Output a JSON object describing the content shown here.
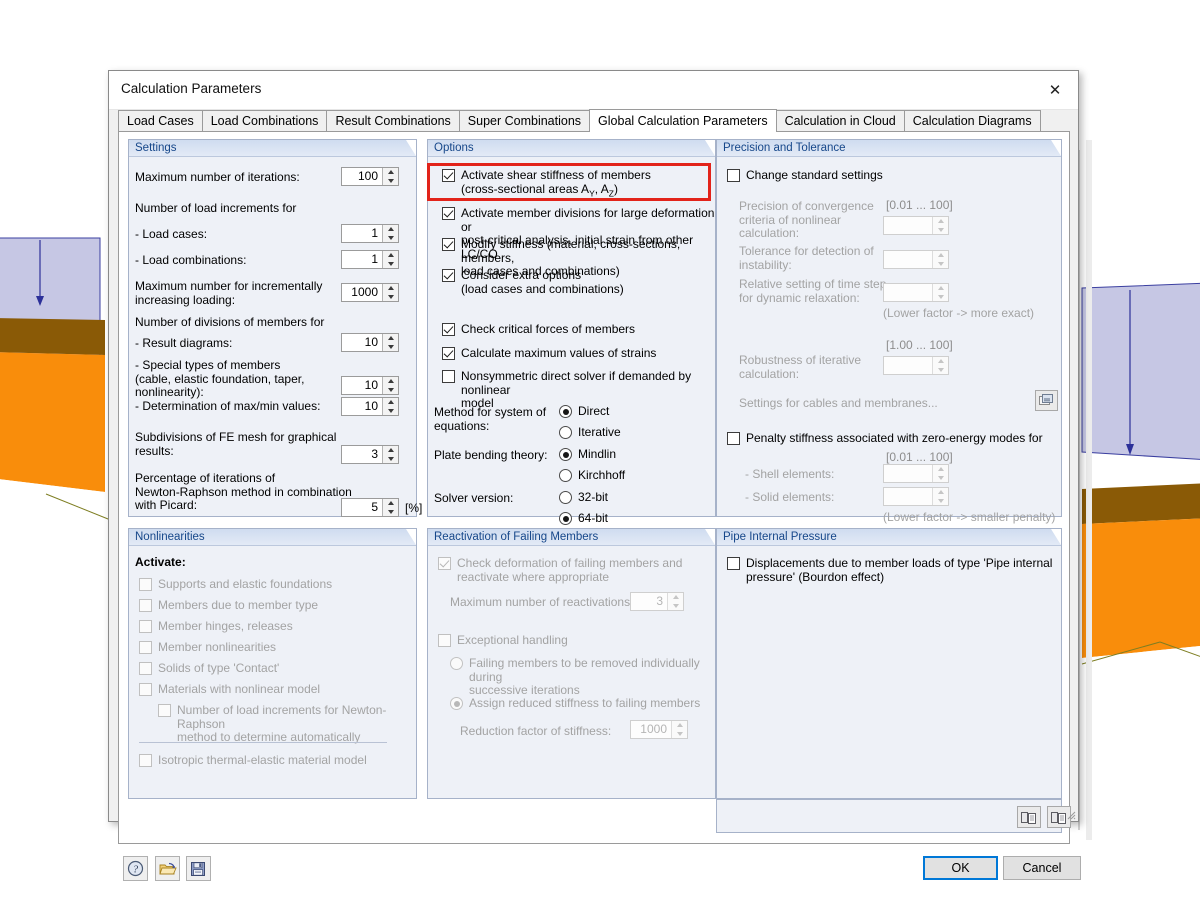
{
  "window": {
    "title": "Calculation Parameters",
    "close_icon": "close-icon"
  },
  "tabs": [
    {
      "label": "Load Cases",
      "active": false
    },
    {
      "label": "Load Combinations",
      "active": false
    },
    {
      "label": "Result Combinations",
      "active": false
    },
    {
      "label": "Super Combinations",
      "active": false
    },
    {
      "label": "Global Calculation Parameters",
      "active": true
    },
    {
      "label": "Calculation in Cloud",
      "active": false
    },
    {
      "label": "Calculation Diagrams",
      "active": false
    }
  ],
  "settings": {
    "title": "Settings",
    "max_iterations_label": "Maximum number of iterations:",
    "max_iterations_value": "100",
    "load_increments_header": "Number of load increments for",
    "load_cases_label": "- Load cases:",
    "load_cases_value": "1",
    "load_combinations_label": "- Load combinations:",
    "load_combinations_value": "1",
    "incremental_label": "Maximum number for incrementally\nincreasing loading:",
    "incremental_value": "1000",
    "divisions_header": "Number of divisions of members for",
    "result_diagrams_label": "- Result diagrams:",
    "result_diagrams_value": "10",
    "special_members_label": "- Special types of members\n  (cable, elastic foundation, taper,\n  nonlinearity):",
    "special_members_value": "10",
    "maxmin_label": "- Determination of max/min values:",
    "maxmin_value": "10",
    "fe_mesh_label": "Subdivisions of FE mesh for graphical\nresults:",
    "fe_mesh_value": "3",
    "newton_raphson_label": "Percentage of iterations of\nNewton-Raphson method in combination\nwith Picard:",
    "newton_raphson_value": "5",
    "newton_raphson_unit": "[%]"
  },
  "options": {
    "title": "Options",
    "shear_stiffness_line1": "Activate shear stiffness of members",
    "shear_stiffness_line2_pre": "(cross-sectional areas A",
    "shear_stiffness_sub1": "Y",
    "shear_stiffness_mid": ", A",
    "shear_stiffness_sub2": "Z",
    "shear_stiffness_end": ")",
    "shear_stiffness_checked": true,
    "highlight_color": "#e2231a",
    "member_divisions": "Activate member divisions for large deformation or\npost-critical analysis, initial strain from other LC/CO",
    "member_divisions_checked": true,
    "modify_stiffness": "Modify stiffness (material, cross-sections, members,\nload cases and combinations)",
    "modify_stiffness_checked": true,
    "extra_options": "Consider extra options\n(load cases and combinations)",
    "extra_options_checked": true,
    "check_critical_forces": "Check critical forces of members",
    "check_critical_forces_checked": true,
    "calc_max_strains": "Calculate maximum values of strains",
    "calc_max_strains_checked": true,
    "nonsymmetric_solver": "Nonsymmetric direct solver if demanded by nonlinear\nmodel",
    "nonsymmetric_solver_checked": false,
    "method_label": "Method for system of\nequations:",
    "method_options": [
      "Direct",
      "Iterative"
    ],
    "method_selected": "Direct",
    "plate_label": "Plate bending theory:",
    "plate_options": [
      "Mindlin",
      "Kirchhoff"
    ],
    "plate_selected": "Mindlin",
    "solver_label": "Solver version:",
    "solver_options": [
      "32-bit",
      "64-bit"
    ],
    "solver_selected": "64-bit"
  },
  "precision": {
    "title": "Precision and Tolerance",
    "change_standard_label": "Change standard settings",
    "change_standard_checked": false,
    "convergence_label": "Precision of convergence\ncriteria of nonlinear\ncalculation:",
    "convergence_range": "[0.01 ... 100]",
    "convergence_value": "",
    "instability_label": "Tolerance for detection of\ninstability:",
    "instability_value": "",
    "timestep_label": "Relative setting of time step\nfor dynamic relaxation:",
    "timestep_value": "",
    "timestep_hint": "(Lower factor -> more exact)",
    "robustness_range": "[1.00 ... 100]",
    "robustness_label": "Robustness of iterative\ncalculation:",
    "robustness_value": "",
    "cables_membranes_label": "Settings for cables and membranes...",
    "cables_membranes_icon": "settings-dialog-icon",
    "penalty_label": "Penalty stiffness associated with zero-energy modes for",
    "penalty_checked": false,
    "penalty_range": "[0.01 ... 100]",
    "shell_label": "- Shell elements:",
    "shell_value": "",
    "solid_label": "- Solid elements:",
    "solid_value": "",
    "penalty_hint": "(Lower factor -> smaller penalty)"
  },
  "nonlinearities": {
    "title": "Nonlinearities",
    "activate_label": "Activate:",
    "items": [
      {
        "label": "Supports and elastic foundations",
        "checked": false
      },
      {
        "label": "Members due to member type",
        "checked": false
      },
      {
        "label": "Member hinges, releases",
        "checked": false
      },
      {
        "label": "Member nonlinearities",
        "checked": false
      },
      {
        "label": "Solids of type 'Contact'",
        "checked": false
      },
      {
        "label": "Materials with nonlinear model",
        "checked": false
      }
    ],
    "sub_item_label": "Number of load increments for Newton-Raphson\nmethod to determine automatically",
    "sub_item_checked": false,
    "isotropic_label": "Isotropic thermal-elastic material model",
    "isotropic_checked": false
  },
  "reactivation": {
    "title": "Reactivation of Failing Members",
    "check_deformation_label": "Check deformation of failing members and\nreactivate where appropriate",
    "check_deformation_checked": true,
    "max_reactivations_label": "Maximum number of reactivations:",
    "max_reactivations_value": "3",
    "exceptional_label": "Exceptional handling",
    "exceptional_checked": false,
    "remove_individually_label": "Failing members to be removed individually during\nsuccessive iterations",
    "remove_individually_selected": false,
    "reduced_stiffness_label": "Assign reduced stiffness to failing members",
    "reduced_stiffness_selected": true,
    "reduction_factor_label": "Reduction factor of stiffness:",
    "reduction_factor_value": "1000"
  },
  "pipe": {
    "title": "Pipe Internal Pressure",
    "displacement_label": "Displacements due to member loads of type 'Pipe internal\npressure' (Bourdon effect)",
    "displacement_checked": false,
    "copy_icon_1": "copy-to-icon",
    "copy_icon_2": "copy-from-icon"
  },
  "footer": {
    "help_icon": "help-icon",
    "open_icon": "open-folder-icon",
    "save_icon": "save-icon",
    "ok_label": "OK",
    "cancel_label": "Cancel",
    "resize_grip_icon": "resize-grip-icon"
  },
  "background": {
    "description": "3D structural model viewport",
    "slab_color": "#f98d0b",
    "slab_edge_color": "#8a5a06",
    "load_surface_color": "#c6c7e4",
    "load_arrow_color": "#2c3099"
  }
}
